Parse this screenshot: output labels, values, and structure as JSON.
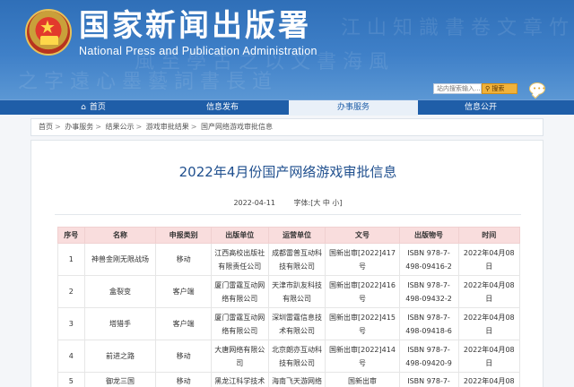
{
  "header": {
    "site_name_cn": "国家新闻出版署",
    "site_name_en": "National Press and Publication Administration",
    "search_placeholder": "站内搜索输入...",
    "search_button": "搜索",
    "calligraphy": [
      "風 至 學 古 之 以 文 書 海 風",
      "之 字 遠 心 墨 藝 詞 書 長 道",
      "江 山 知 識 書 卷 文 章 竹"
    ]
  },
  "nav": {
    "items": [
      {
        "label": "首页",
        "active": false
      },
      {
        "label": "信息发布",
        "active": false
      },
      {
        "label": "办事服务",
        "active": true
      },
      {
        "label": "信息公开",
        "active": false
      }
    ]
  },
  "breadcrumb": [
    "首页",
    "办事服务",
    "结果公示",
    "游戏审批结果",
    "国产网络游戏审批信息"
  ],
  "article": {
    "title": "2022年4月份国产网络游戏审批信息",
    "date": "2022-04-11",
    "font_size_label": "字体:[大 中 小]"
  },
  "table": {
    "headers": [
      "序号",
      "名称",
      "申报类别",
      "出版单位",
      "运营单位",
      "文号",
      "出版物号",
      "时间"
    ],
    "rows": [
      [
        "1",
        "神兽金刚无限战场",
        "移动",
        "江西高校出版社有限责任公司",
        "成都雷普互动科技有限公司",
        "国新出审[2022]417号",
        "ISBN 978-7-498-09416-2",
        "2022年04月08日"
      ],
      [
        "2",
        "盒裂变",
        "客户端",
        "厦门雷霆互动网络有限公司",
        "天津市趴友科技有限公司",
        "国新出审[2022]416号",
        "ISBN 978-7-498-09432-2",
        "2022年04月08日"
      ],
      [
        "3",
        "塔猎手",
        "客户端",
        "厦门雷霆互动网络有限公司",
        "深圳雷霆信息技术有限公司",
        "国新出审[2022]415号",
        "ISBN 978-7-498-09418-6",
        "2022年04月08日"
      ],
      [
        "4",
        "前进之路",
        "移动",
        "大唐网络有限公司",
        "北京朗亦互动科技有限公司",
        "国新出审[2022]414号",
        "ISBN 978-7-498-09420-9",
        "2022年04月08日"
      ],
      [
        "5",
        "御龙三国",
        "移动",
        "黑龙江科学技术出版",
        "海南飞天游网络科技",
        "国新出审",
        "ISBN 978-7-",
        "2022年04月08日"
      ]
    ]
  },
  "colors": {
    "header_blue": "#3f80c8",
    "nav_blue": "#1f5ea8",
    "title_blue": "#1f4f8e",
    "table_header_pink": "#f9dddd",
    "search_button_orange": "#f0b23b"
  }
}
